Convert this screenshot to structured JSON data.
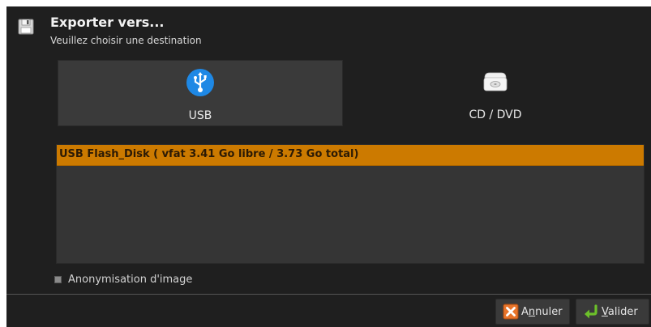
{
  "dialog": {
    "title": "Exporter vers...",
    "subtitle": "Veuillez choisir une destination",
    "header_icon": "floppy-disk-icon"
  },
  "destinations": [
    {
      "label": "USB",
      "icon": "usb-icon",
      "selected": true
    },
    {
      "label": "CD / DVD",
      "icon": "optical-drive-icon",
      "selected": false
    }
  ],
  "devices": [
    {
      "label": "USB Flash_Disk ( vfat 3.41 Go libre / 3.73 Go total)",
      "selected": true
    }
  ],
  "anonymization": {
    "label": "Anonymisation d'image",
    "checked": false
  },
  "buttons": {
    "cancel": {
      "prefix": "A",
      "mnemonic": "n",
      "suffix": "nuler",
      "icon": "cancel-x-icon"
    },
    "ok": {
      "prefix": "",
      "mnemonic": "V",
      "suffix": "alider",
      "icon": "return-arrow-icon"
    }
  },
  "colors": {
    "background": "#1f1f1f",
    "selection": "#cc7a00",
    "usb_icon": "#1e88e5",
    "cancel_icon": "#e8742a",
    "ok_icon": "#6cc02a"
  }
}
